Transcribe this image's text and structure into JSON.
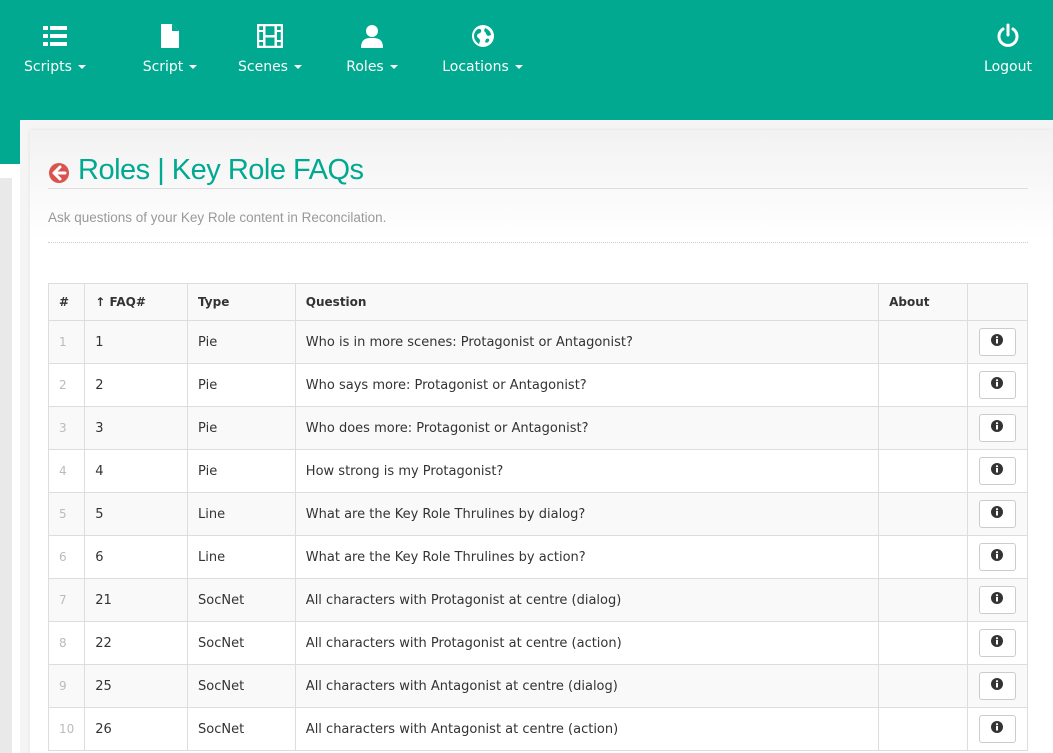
{
  "nav": {
    "items": [
      {
        "label": "Scripts",
        "icon": "list-icon"
      },
      {
        "label": "Script",
        "icon": "file-icon"
      },
      {
        "label": "Scenes",
        "icon": "film-icon"
      },
      {
        "label": "Roles",
        "icon": "user-icon"
      },
      {
        "label": "Locations",
        "icon": "globe-icon"
      }
    ],
    "logout_label": "Logout"
  },
  "page": {
    "title": "Roles | Key Role FAQs",
    "subtitle": "Ask questions of your Key Role content in Reconcilation."
  },
  "table": {
    "headers": {
      "num": "#",
      "faq": "↑ FAQ#",
      "type": "Type",
      "question": "Question",
      "about": "About"
    },
    "rows": [
      {
        "num": "1",
        "faq": "1",
        "type": "Pie",
        "question": "Who is in more scenes: Protagonist or Antagonist?",
        "about": ""
      },
      {
        "num": "2",
        "faq": "2",
        "type": "Pie",
        "question": "Who says more: Protagonist or Antagonist?",
        "about": ""
      },
      {
        "num": "3",
        "faq": "3",
        "type": "Pie",
        "question": "Who does more: Protagonist or Antagonist?",
        "about": ""
      },
      {
        "num": "4",
        "faq": "4",
        "type": "Pie",
        "question": "How strong is my Protagonist?",
        "about": ""
      },
      {
        "num": "5",
        "faq": "5",
        "type": "Line",
        "question": "What are the Key Role Thrulines by dialog?",
        "about": ""
      },
      {
        "num": "6",
        "faq": "6",
        "type": "Line",
        "question": "What are the Key Role Thrulines by action?",
        "about": ""
      },
      {
        "num": "7",
        "faq": "21",
        "type": "SocNet",
        "question": "All characters with Protagonist at centre (dialog)",
        "about": ""
      },
      {
        "num": "8",
        "faq": "22",
        "type": "SocNet",
        "question": "All characters with Protagonist at centre (action)",
        "about": ""
      },
      {
        "num": "9",
        "faq": "25",
        "type": "SocNet",
        "question": "All characters with Antagonist at centre (dialog)",
        "about": ""
      },
      {
        "num": "10",
        "faq": "26",
        "type": "SocNet",
        "question": "All characters with Antagonist at centre (action)",
        "about": ""
      }
    ]
  },
  "colors": {
    "brand": "#00a98f",
    "back_icon": "#d9534f"
  }
}
